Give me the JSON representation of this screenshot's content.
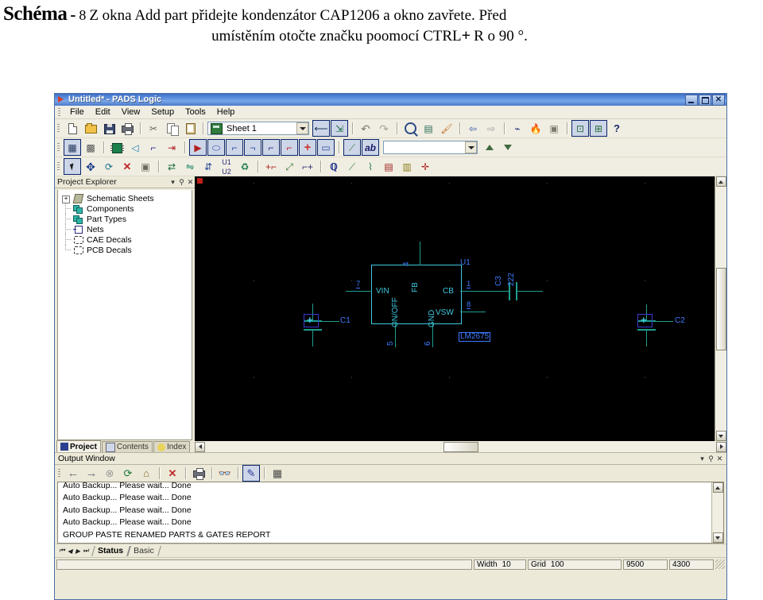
{
  "caption": {
    "heading": "Schéma",
    "dash": "-",
    "step_number": "8",
    "line1_text": "Z okna Add part přidejte kondenzátor CAP1206  a okno zavřete. Před",
    "line2_pre": "umístěním otočte značku poomocí CTRL",
    "line2_plus": "+",
    "line2_post": "R o 90 °."
  },
  "window": {
    "title": "Untitled* - PADS Logic",
    "minimize": "_",
    "maximize": "□",
    "close": "✕"
  },
  "menu": [
    "File",
    "Edit",
    "View",
    "Setup",
    "Tools",
    "Help"
  ],
  "toolbar_standard": {
    "sheet_combo_value": "Sheet 1",
    "items": [
      {
        "name": "new-file-icon",
        "tip": "New"
      },
      {
        "name": "open-file-icon",
        "tip": "Open"
      },
      {
        "name": "save-icon",
        "tip": "Save"
      },
      {
        "name": "print-icon",
        "tip": "Print"
      },
      {
        "name": "cut-icon",
        "tip": "Cut"
      },
      {
        "name": "copy-icon",
        "tip": "Copy"
      },
      {
        "name": "paste-icon",
        "tip": "Paste"
      },
      {
        "name": "select-tool-icon",
        "tip": "Select"
      },
      {
        "name": "select-alt-tool-icon",
        "tip": "Select Alternate"
      },
      {
        "name": "undo-icon",
        "tip": "Undo"
      },
      {
        "name": "redo-icon",
        "tip": "Redo"
      },
      {
        "name": "zoom-icon",
        "tip": "Zoom"
      },
      {
        "name": "view-board-icon",
        "tip": "View Board"
      },
      {
        "name": "paintbrush-icon",
        "tip": "Redraw"
      },
      {
        "name": "prev-sheet-icon",
        "tip": "Previous Sheet"
      },
      {
        "name": "next-sheet-icon",
        "tip": "Next Sheet"
      },
      {
        "name": "netlist-icon",
        "tip": "Netlist"
      },
      {
        "name": "flame-icon",
        "tip": "Hot Key"
      },
      {
        "name": "properties-icon",
        "tip": "Properties"
      },
      {
        "name": "pads-layout-icon",
        "tip": "PADS Layout"
      },
      {
        "name": "pads-router-icon",
        "tip": "PADS Router"
      },
      {
        "name": "help-icon",
        "tip": "Help"
      }
    ]
  },
  "toolbar_drawing": {
    "combo_value": "",
    "items": [
      {
        "name": "select-net-icon"
      },
      {
        "name": "select-net-alt-icon"
      },
      {
        "name": "add-part-icon"
      },
      {
        "name": "add-gate-icon"
      },
      {
        "name": "add-connection-icon"
      },
      {
        "name": "rename-net-icon"
      },
      {
        "name": "add-bus-icon"
      },
      {
        "name": "add-off-page-icon"
      },
      {
        "name": "add-terminal-icon"
      },
      {
        "name": "add-pin-icon"
      },
      {
        "name": "add-signal-icon"
      },
      {
        "name": "add-power-icon"
      },
      {
        "name": "add-ground-icon"
      },
      {
        "name": "add-junction-icon"
      },
      {
        "name": "add-field-icon"
      },
      {
        "name": "draw-line-icon"
      },
      {
        "name": "add-text-icon"
      },
      {
        "name": "up-arrow-icon"
      },
      {
        "name": "down-arrow-icon"
      }
    ]
  },
  "toolbar_edit": {
    "items": [
      {
        "name": "pointer-icon"
      },
      {
        "name": "move-icon"
      },
      {
        "name": "rotate-icon"
      },
      {
        "name": "delete-icon"
      },
      {
        "name": "properties-dialog-icon"
      },
      {
        "name": "swap-part-icon"
      },
      {
        "name": "swap-gate-icon"
      },
      {
        "name": "swap-pins-icon"
      },
      {
        "name": "renumber-icon"
      },
      {
        "name": "recycle-icon"
      },
      {
        "name": "add-label-icon"
      },
      {
        "name": "move-label-icon"
      },
      {
        "name": "attach-label-icon"
      },
      {
        "name": "query-icon"
      },
      {
        "name": "measure-icon"
      },
      {
        "name": "highlight-icon"
      },
      {
        "name": "bom-report-icon"
      },
      {
        "name": "library-icon"
      },
      {
        "name": "add-misc-icon"
      }
    ]
  },
  "project_explorer": {
    "title": "Project Explorer",
    "menu_glyph": "▾",
    "pin_glyph": "⚲",
    "close_glyph": "✕",
    "tree": [
      {
        "label": "Schematic Sheets",
        "icon": "schematic-sheets-icon",
        "expandable": true,
        "expander": "+"
      },
      {
        "label": "Components",
        "icon": "components-icon",
        "expandable": false
      },
      {
        "label": "Part Types",
        "icon": "part-types-icon",
        "expandable": false
      },
      {
        "label": "Nets",
        "icon": "nets-icon",
        "expandable": false
      },
      {
        "label": "CAE Decals",
        "icon": "cae-decals-icon",
        "expandable": false
      },
      {
        "label": "PCB Decals",
        "icon": "pcb-decals-icon",
        "expandable": false
      }
    ],
    "tabs": [
      {
        "label": "Project",
        "icon": "project-icon",
        "active": true
      },
      {
        "label": "Contents",
        "icon": "book-icon",
        "active": false
      },
      {
        "label": "Index",
        "icon": "bulb-icon",
        "active": false
      }
    ]
  },
  "schematic": {
    "ic": {
      "reference": "U1",
      "part_name": "LM2675",
      "pins": [
        {
          "name": "VIN",
          "number": "7",
          "side": "left"
        },
        {
          "name": "ON/OFF",
          "number": "5",
          "side": "bottom"
        },
        {
          "name": "GND",
          "number": "6",
          "side": "bottom"
        },
        {
          "name": "FB",
          "number": "4",
          "side": "top"
        },
        {
          "name": "CB",
          "number": "1",
          "side": "right"
        },
        {
          "name": "VSW",
          "number": "8",
          "side": "right"
        }
      ]
    },
    "components": [
      {
        "reference": "C1",
        "type": "polarized-capacitor",
        "value": ""
      },
      {
        "reference": "C2",
        "type": "polarized-capacitor",
        "value": ""
      },
      {
        "reference": "C3",
        "type": "capacitor",
        "value": "222"
      }
    ]
  },
  "output_window": {
    "title": "Output Window",
    "toolbar": [
      {
        "name": "back-icon"
      },
      {
        "name": "forward-icon"
      },
      {
        "name": "stop-icon"
      },
      {
        "name": "refresh-icon"
      },
      {
        "name": "home-icon"
      },
      {
        "name": "clear-icon"
      },
      {
        "name": "print-icon"
      },
      {
        "name": "find-icon"
      },
      {
        "name": "edit-icon"
      },
      {
        "name": "grid-icon"
      }
    ],
    "lines": [
      "Auto Backup... Please wait... Done",
      "Auto Backup... Please wait... Done",
      "Auto Backup... Please wait... Done",
      "Auto Backup... Please wait... Done",
      "GROUP PASTE RENAMED PARTS & GATES REPORT"
    ],
    "tabs": [
      {
        "label": "Status",
        "active": true
      },
      {
        "label": "Basic",
        "active": false
      }
    ],
    "nav": [
      "⏮",
      "◀",
      "▶",
      "⏭"
    ]
  },
  "statusbar": {
    "width_label": "Width",
    "width_value": "10",
    "grid_label": "Grid",
    "grid_value": "100",
    "coord_x": "9500",
    "coord_y": "4300"
  },
  "colors": {
    "title_blue": "#3e6fc4",
    "canvas_black": "#000000",
    "wire_teal": "#1f9e8e",
    "label_blue": "#3d7bff",
    "body_cyan": "#3fc8e0",
    "origin_red": "#c0201c",
    "chrome": "#ece9d8"
  }
}
